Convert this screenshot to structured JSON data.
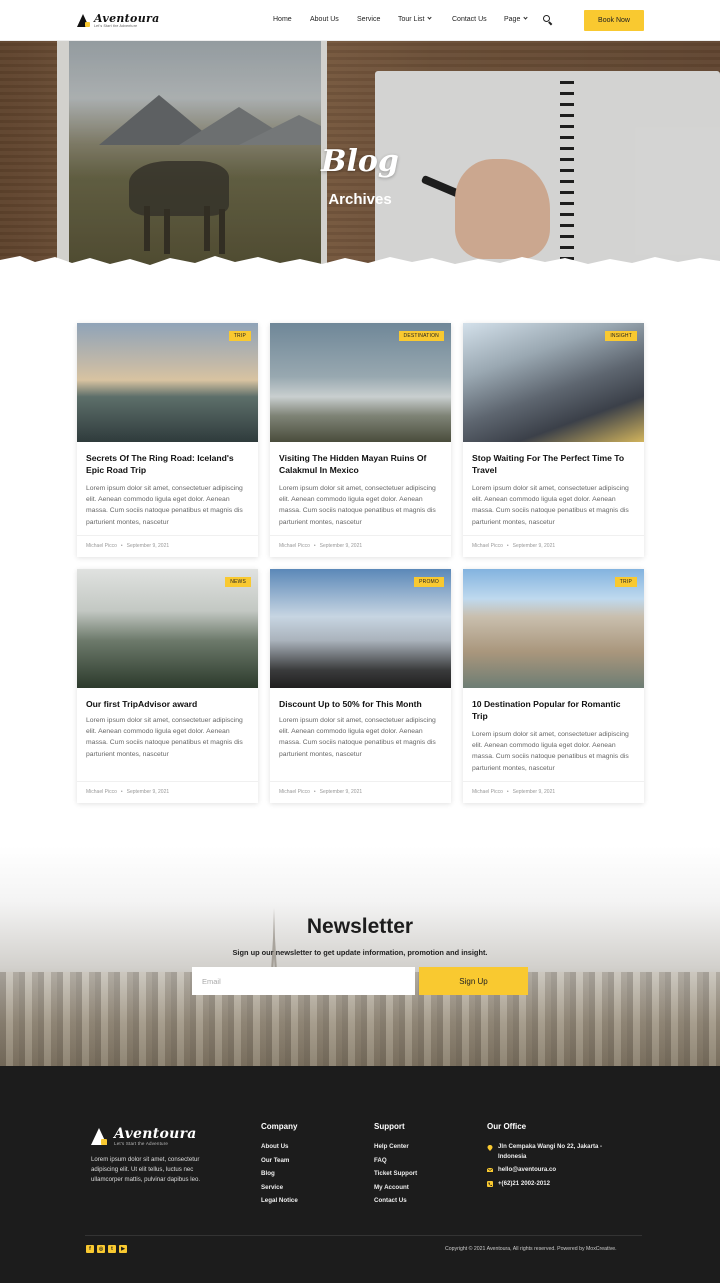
{
  "header": {
    "logo_name": "Aventoura",
    "logo_tagline": "Let's Start the Adventure",
    "nav": [
      "Home",
      "About Us",
      "Service",
      "Tour List",
      "Contact Us",
      "Page"
    ],
    "book_label": "Book Now"
  },
  "hero": {
    "title": "Blog",
    "subtitle": "Archives"
  },
  "posts": [
    {
      "badge": "TRIP",
      "title": "Secrets Of The Ring Road: Iceland's Epic Road Trip",
      "excerpt": "Lorem ipsum dolor sit amet, consectetuer adipiscing elit. Aenean commodo ligula eget dolor. Aenean massa. Cum sociis natoque penatibus et magnis dis parturient montes, nascetur",
      "author": "Michael Picco",
      "date": "September 9, 2021"
    },
    {
      "badge": "DESTINATION",
      "title": "Visiting The Hidden Mayan Ruins Of Calakmul In Mexico",
      "excerpt": "Lorem ipsum dolor sit amet, consectetuer adipiscing elit. Aenean commodo ligula eget dolor. Aenean massa. Cum sociis natoque penatibus et magnis dis parturient montes, nascetur",
      "author": "Michael Picco",
      "date": "September 9, 2021"
    },
    {
      "badge": "INSIGHT",
      "title": "Stop Waiting For The Perfect Time To Travel",
      "excerpt": "Lorem ipsum dolor sit amet, consectetuer adipiscing elit. Aenean commodo ligula eget dolor. Aenean massa. Cum sociis natoque penatibus et magnis dis parturient montes, nascetur",
      "author": "Michael Picco",
      "date": "September 9, 2021"
    },
    {
      "badge": "NEWS",
      "title": "Our first TripAdvisor award",
      "excerpt": "Lorem ipsum dolor sit amet, consectetuer adipiscing elit. Aenean commodo ligula eget dolor. Aenean massa. Cum sociis natoque penatibus et magnis dis parturient montes, nascetur",
      "author": "Michael Picco",
      "date": "September 9, 2021"
    },
    {
      "badge": "PROMO",
      "title": "Discount Up to 50% for This Month",
      "excerpt": "Lorem ipsum dolor sit amet, consectetuer adipiscing elit. Aenean commodo ligula eget dolor. Aenean massa. Cum sociis natoque penatibus et magnis dis parturient montes, nascetur",
      "author": "Michael Picco",
      "date": "September 9, 2021"
    },
    {
      "badge": "TRIP",
      "title": "10 Destination Popular for Romantic Trip",
      "excerpt": "Lorem ipsum dolor sit amet, consectetuer adipiscing elit. Aenean commodo ligula eget dolor. Aenean massa. Cum sociis natoque penatibus et magnis dis parturient montes, nascetur",
      "author": "Michael Picco",
      "date": "September 9, 2021"
    }
  ],
  "newsletter": {
    "title": "Newsletter",
    "subtitle": "Sign up our newsletter to get update information, promotion and insight.",
    "placeholder": "Email",
    "button": "Sign Up"
  },
  "footer": {
    "description": "Lorem ipsum dolor sit amet, consectetur adipiscing elit. Ut elit tellus, luctus nec ullamcorper mattis, pulvinar dapibus leo.",
    "company_title": "Company",
    "company_links": [
      "About Us",
      "Our Team",
      "Blog",
      "Service",
      "Legal Notice"
    ],
    "support_title": "Support",
    "support_links": [
      "Help Center",
      "FAQ",
      "Ticket Support",
      "My Account",
      "Contact Us"
    ],
    "office_title": "Our Office",
    "address": "Jln Cempaka Wangi No 22, Jakarta - Indonesia",
    "email": "hello@aventoura.co",
    "phone": "+(62)21 2002-2012",
    "social": [
      "facebook-icon",
      "instagram-icon",
      "twitter-icon",
      "youtube-icon"
    ],
    "copyright": "Copyright © 2021 Aventoura, All rights reserved. Powered by MoxCreative."
  },
  "colors": {
    "accent": "#f9c930",
    "footer_bg": "#1c1c1c"
  }
}
